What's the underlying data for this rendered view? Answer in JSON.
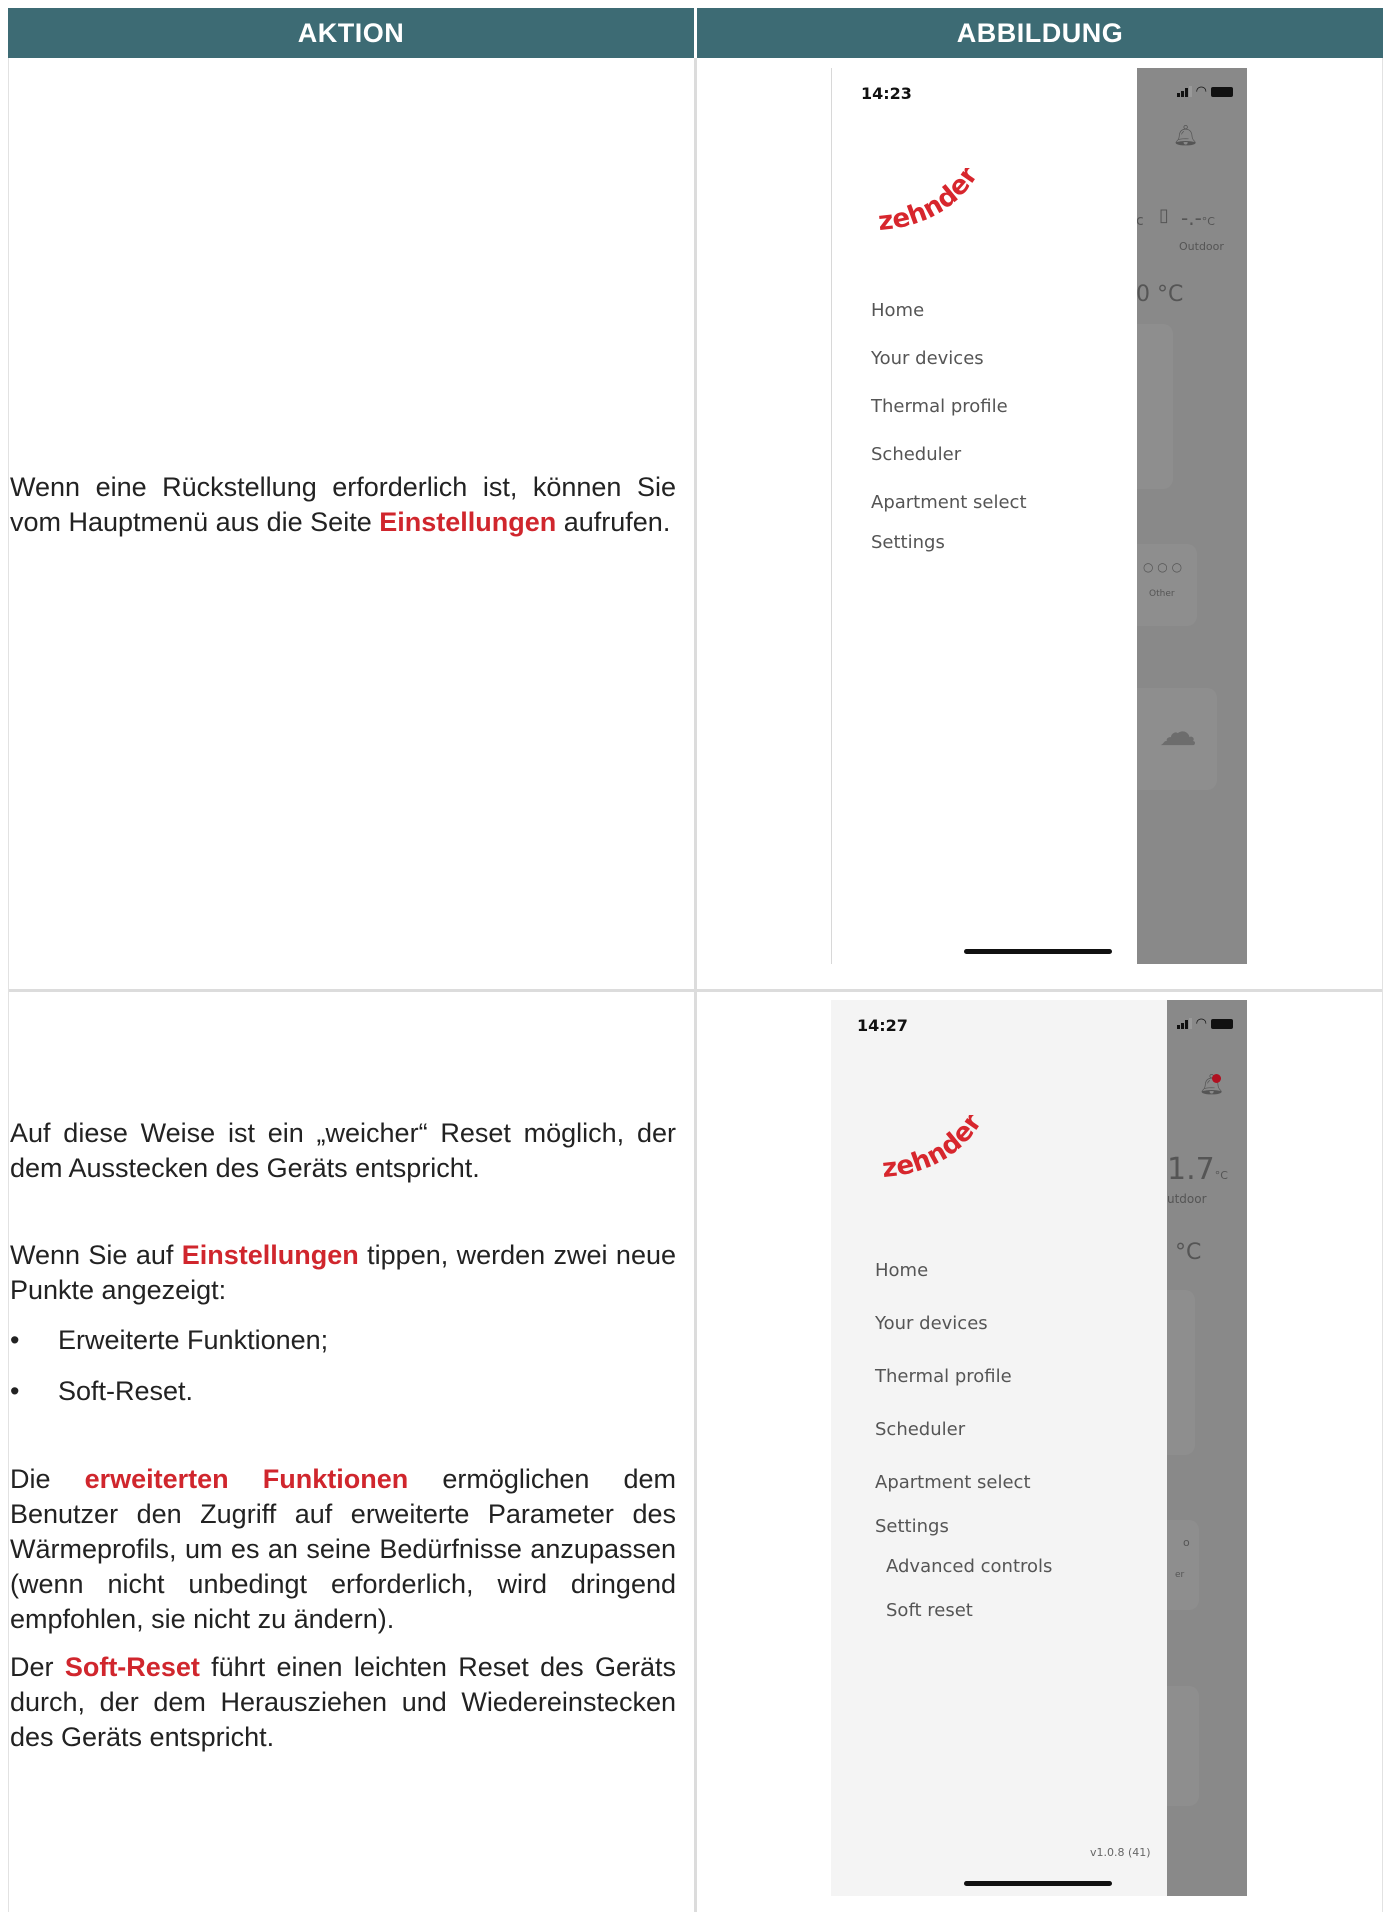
{
  "header": {
    "action": "AKTION",
    "figure": "ABBILDUNG"
  },
  "row1": {
    "text_before": "Wenn eine Rückstellung erforderlich ist, können Sie vom Hauptmenü aus die Seite ",
    "text_highlight": "Einstellungen",
    "text_after": " aufrufen."
  },
  "row2": {
    "p1": "Auf diese Weise ist ein „weicher“ Reset möglich, der dem Ausstecken des Geräts entspricht.",
    "p2_before": "Wenn Sie auf ",
    "p2_highlight": "Einstellungen",
    "p2_after": " tippen, werden zwei neue Punkte angezeigt:",
    "bullet_symbol": "•",
    "bullets": [
      "Erweiterte Funktionen;",
      "Soft-Reset."
    ],
    "p3_before": "Die ",
    "p3_highlight": "erweiterten Funktionen",
    "p3_after": " ermöglichen dem Benutzer den Zugriff auf erweiterte Parameter des Wärmeprofils, um es an seine Bedürfnisse anzupassen (wenn nicht unbedingt erforderlich, wird dringend empfohlen, sie nicht zu ändern).",
    "p4_before": "Der ",
    "p4_highlight": "Soft-Reset",
    "p4_after": " führt einen leichten Reset des Geräts durch, der dem Herausziehen und Wiedereinstecken des Geräts entspricht."
  },
  "phone1": {
    "time": "14:23",
    "logo": "zehnder",
    "menu": [
      "Home",
      "Your devices",
      "Thermal profile",
      "Scheduler",
      "Apartment select",
      "Settings"
    ],
    "bg": {
      "temp_fragment": "0 °C",
      "outdoor_value": "-.-",
      "outdoor_unit": "°C",
      "outdoor_label": "Outdoor",
      "other_label": "Other",
      "dots": "○ ○ ○",
      "c_fragment": "c"
    }
  },
  "phone2": {
    "time": "14:27",
    "logo": "zehnder",
    "menu": [
      "Home",
      "Your devices",
      "Thermal profile",
      "Scheduler",
      "Apartment select",
      "Settings"
    ],
    "submenu": [
      "Advanced controls",
      "Soft reset"
    ],
    "version": "v1.0.8 (41)",
    "bg": {
      "temp_value": "1.7",
      "temp_unit": "°C",
      "outdoor_label": "utdoor",
      "temp_fragment": "°C",
      "small_o": "o",
      "small_r": "er"
    }
  },
  "colors": {
    "header_bg": "#3d6b74",
    "highlight": "#d0262d",
    "logo_red": "#d7262d",
    "notification_dot": "#b01020"
  }
}
